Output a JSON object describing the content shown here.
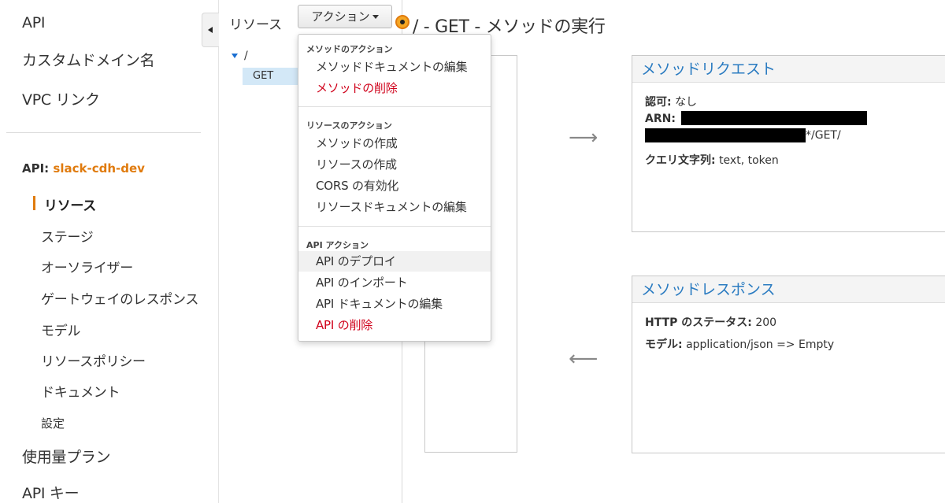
{
  "sidebar": {
    "top_items": [
      "API",
      "カスタムドメイン名",
      "VPC リンク"
    ],
    "api_prefix": "API: ",
    "api_name": "slack-cdh-dev",
    "sub_items": [
      "リソース",
      "ステージ",
      "オーソライザー",
      "ゲートウェイのレスポンス",
      "モデル",
      "リソースポリシー",
      "ドキュメント"
    ],
    "settings": "設定",
    "bottom_items": [
      "使用量プラン",
      "API キー"
    ]
  },
  "resources": {
    "title": "リソース",
    "action_button": "アクション",
    "tree_root": "/",
    "tree_method": "GET"
  },
  "dropdown": {
    "section1_header": "メソッドのアクション",
    "section1_items": [
      "メソッドドキュメントの編集",
      "メソッドの削除"
    ],
    "section2_header": "リソースのアクション",
    "section2_items": [
      "メソッドの作成",
      "リソースの作成",
      "CORS の有効化",
      "リソースドキュメントの編集"
    ],
    "section3_header": "API アクション",
    "section3_items": [
      "API のデプロイ",
      "API のインポート",
      "API ドキュメントの編集",
      "API の削除"
    ]
  },
  "method": {
    "title": "/ - GET - メソッドの実行",
    "request": {
      "title": "メソッドリクエスト",
      "auth_label": "認可:",
      "auth_value": "なし",
      "arn_label": "ARN:",
      "arn_suffix": "*/GET/",
      "query_label": "クエリ文字列:",
      "query_value": "text, token"
    },
    "response": {
      "title": "メソッドレスポンス",
      "status_label": "HTTP のステータス:",
      "status_value": "200",
      "model_label": "モデル:",
      "model_value": "application/json => Empty"
    }
  },
  "colors": {
    "accent_orange": "#e07b0e",
    "link_blue": "#2a7bc1",
    "danger_red": "#d0021b",
    "selected_bg": "#d3e8f7"
  }
}
